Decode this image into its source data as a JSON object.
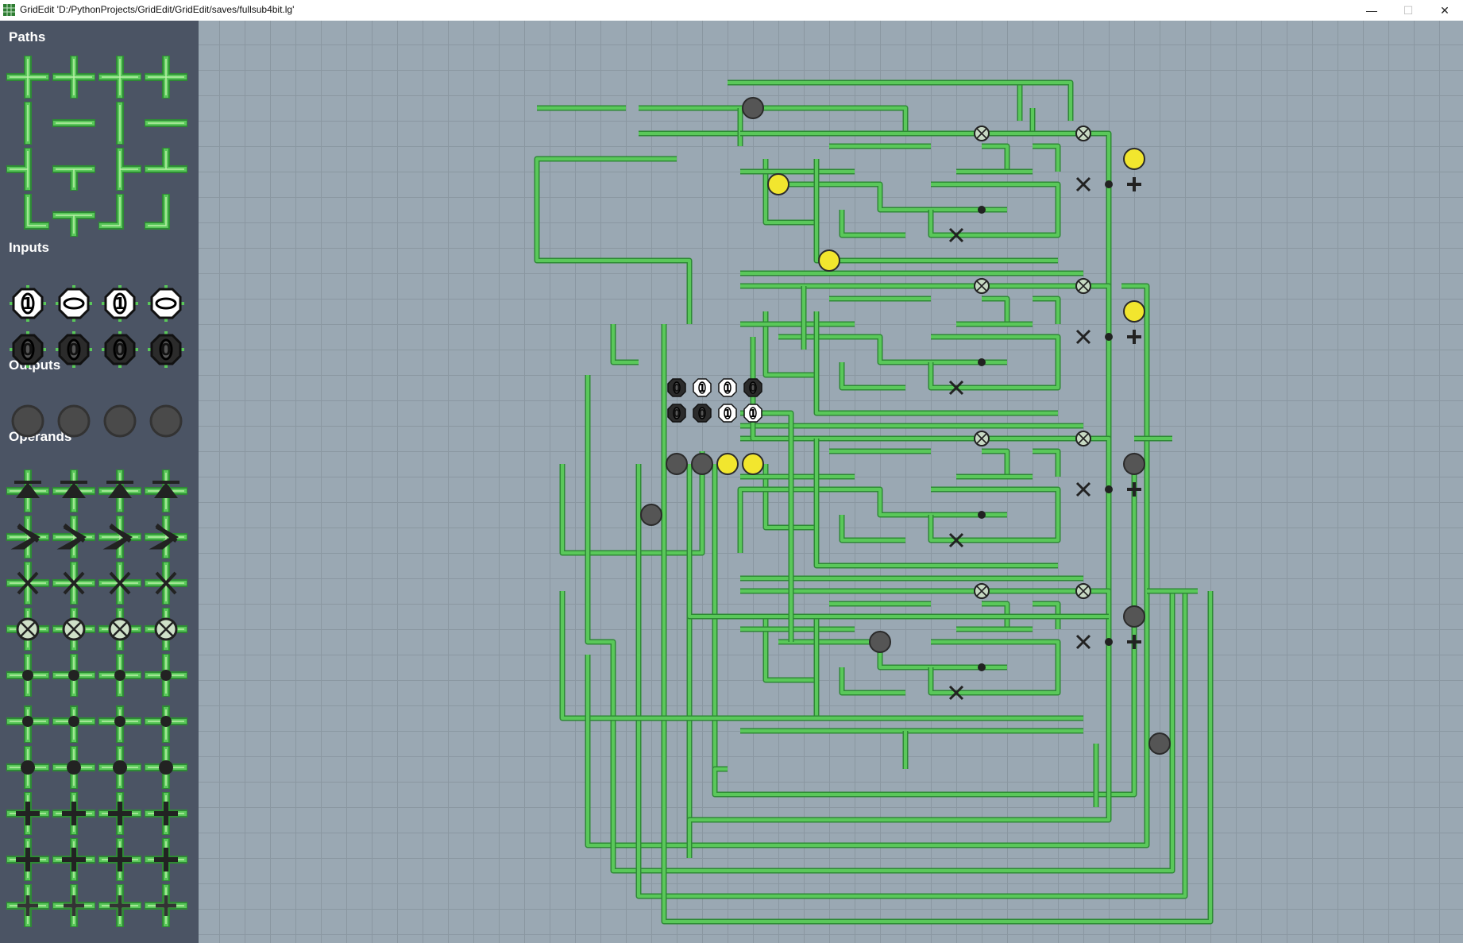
{
  "window": {
    "title": "GridEdit 'D:/PythonProjects/GridEdit/GridEdit/saves/fullsub4bit.lg'",
    "minimize_glyph": "—",
    "maximize_glyph": "☐",
    "close_glyph": "✕"
  },
  "sidebar": {
    "sections": {
      "paths": "Paths",
      "inputs": "Inputs",
      "outputs": "Outputs",
      "operands": "Operands"
    },
    "input_tiles": [
      "1",
      "−",
      "1",
      "−",
      "0",
      "0",
      "0",
      "0"
    ]
  },
  "colors": {
    "sidebar_bg": "#4b5464",
    "canvas_bg": "#9aa8b3",
    "wire": "#5ac85a",
    "wire_edge": "#2e8a35",
    "output_on": "#f2e62e",
    "output_off": "#555555"
  },
  "circuit": {
    "input_labels_row1": [
      "0",
      "1",
      "1",
      "0"
    ],
    "input_labels_row2": [
      "0",
      "0",
      "1",
      "1"
    ]
  }
}
